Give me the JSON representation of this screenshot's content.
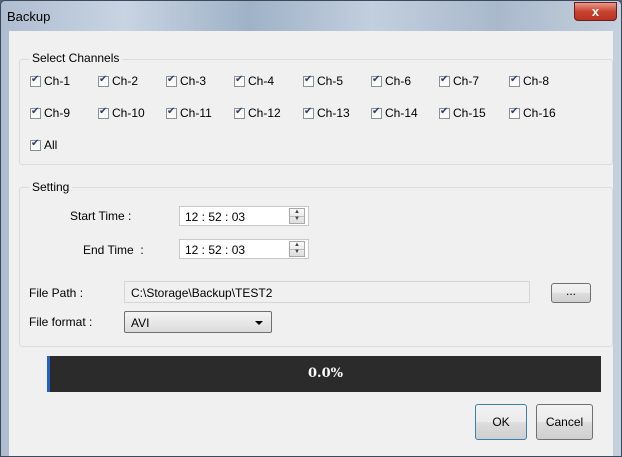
{
  "window": {
    "title": "Backup",
    "close_label": "x"
  },
  "channels": {
    "group_label": "Select Channels",
    "items": [
      "Ch-1",
      "Ch-2",
      "Ch-3",
      "Ch-4",
      "Ch-5",
      "Ch-6",
      "Ch-7",
      "Ch-8",
      "Ch-9",
      "Ch-10",
      "Ch-11",
      "Ch-12",
      "Ch-13",
      "Ch-14",
      "Ch-15",
      "Ch-16"
    ],
    "all_label": "All",
    "checked": true
  },
  "setting": {
    "group_label": "Setting",
    "start_time_label": "Start Time :",
    "start_time_value": "12 : 52 : 03",
    "end_time_label": "End Time  :",
    "end_time_value": "12 : 52 : 03",
    "file_path_label": "File Path :",
    "file_path_value": "C:\\Storage\\Backup\\TEST2",
    "browse_label": "...",
    "file_format_label": "File format :",
    "file_format_value": "AVI"
  },
  "progress": {
    "text": "0.0%",
    "value": 0.0
  },
  "buttons": {
    "ok": "OK",
    "cancel": "Cancel"
  },
  "colors": {
    "progress_bg": "#2b2b2b",
    "progress_accent": "#2460c8",
    "close_button": "#c8432f"
  }
}
